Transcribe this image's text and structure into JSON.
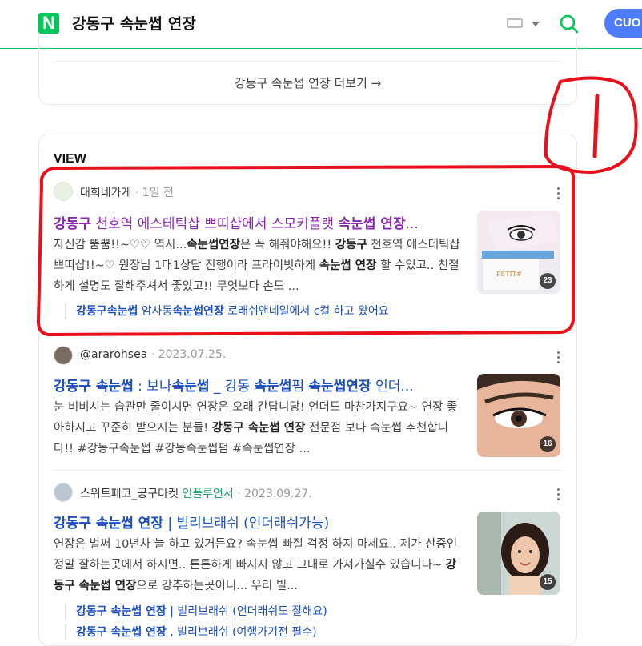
{
  "header": {
    "logo": "N",
    "query": "강동구 속눈썹 연장",
    "account_button": "CUO"
  },
  "more_link": "강동구 속눈썹 연장 더보기 →",
  "view_section": {
    "title": "VIEW",
    "items": [
      {
        "author": "대희네가게",
        "date": "1일 전",
        "title_html": "<b>강동구</b> 천호역 에스테틱샵 쁘띠샵에서 스모키플랫 <b>속눈썹 연장</b>...",
        "desc_html": "자신감 뿜뿜!!~♡♡ 역시...<b>속눈썹연장</b>은 꼭 해줘야해요!! <b>강동구</b> 천호역 에스테틱샵 쁘띠샵!!~♡ 원장님 1대1상담 진행이라 프라이빗하게 <b>속눈썹 연장</b> 할 수있고.. 친절하게 설명도 잘해주셔서 좋았고!! 무엇보다 손도 ...",
        "image_count": "23",
        "sub_link_html": "<b>강동구속눈썹</b> 암사동<b>속눈썹연장</b> 로래쉬앤네일에서 c컬 하고 왔어요"
      },
      {
        "author": "@ararohsea",
        "date": "2023.07.25.",
        "title_html": "<b>강동구 속눈썹</b> : 보나<b>속눈썹</b> _ 강동 <b>속눈썹</b>펌 <b>속눈썹연장</b> 언더...",
        "desc_html": "눈 비비시는 습관만 줄이시면 연장은 오래 간답니당! 언더도 마찬가지구요~ 연장 좋아하시고 꾸준히 받으시는 분들! <b>강동구 속눈썹 연장</b> 전문점 보나 속눈썹 추천합니다!! #강동구속눈썹 #강동속눈썹펌 #속눈썹연장 ...",
        "image_count": "16"
      },
      {
        "author": "스위트페코_공구마켓",
        "influencer": "인플루언서",
        "date": "2023.09.27.",
        "title_html": "<b>강동구 속눈썹 연장</b> | 빌리브래쉬 (언더래쉬가능)",
        "desc_html": "연장은 벌써 10년차 늘 하고 있거든요? 속눈썹 빠질 걱정 하지 마세요.. 제가 산증인 정말 잘하는곳에서 하시면.. 튼튼하게 빠지지 않고 그대로 가져가실수 있습니다~ <b>강동구 속눈썹 연장</b>으로 강추하는곳이니... 우리 빌...",
        "image_count": "15",
        "sub_links_html": [
          "<b>강동구 속눈썹 연장</b> | 빌리브래쉬 (언더래쉬도 잘해요)",
          "<b>강동구 속눈썹 연장</b> , 빌리브래쉬 (여행가기전 필수)"
        ]
      }
    ]
  },
  "annotation": {
    "label": "1",
    "color": "#e8101a"
  }
}
